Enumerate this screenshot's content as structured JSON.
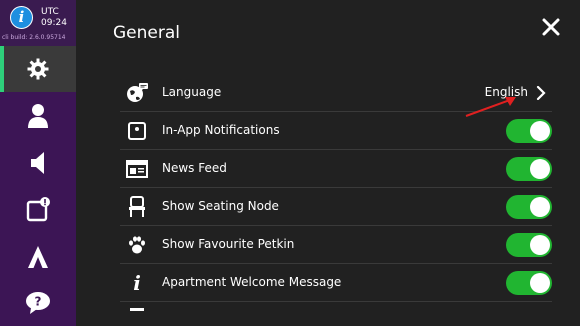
{
  "status": {
    "utc_label": "UTC",
    "time": "09:24",
    "build": "cli build: 2.6.0.95714"
  },
  "sidebar": {
    "items": [
      {
        "name": "settings",
        "icon": "gear-icon",
        "active": true
      },
      {
        "name": "profile",
        "icon": "person-icon",
        "active": false
      },
      {
        "name": "announcements",
        "icon": "megaphone-icon",
        "active": false
      },
      {
        "name": "notifications",
        "icon": "notification-icon",
        "active": false
      },
      {
        "name": "brand",
        "icon": "logo-icon",
        "active": false
      },
      {
        "name": "help",
        "icon": "help-icon",
        "active": false
      }
    ]
  },
  "page": {
    "title": "General"
  },
  "settings": [
    {
      "label": "Language",
      "icon": "globe-chat-icon",
      "value": "English"
    },
    {
      "label": "In-App Notifications",
      "icon": "notification-icon",
      "toggle": true
    },
    {
      "label": "News Feed",
      "icon": "newspaper-icon",
      "toggle": true
    },
    {
      "label": "Show Seating Node",
      "icon": "chair-icon",
      "toggle": true
    },
    {
      "label": "Show Favourite Petkin",
      "icon": "paw-icon",
      "toggle": true
    },
    {
      "label": "Apartment Welcome Message",
      "icon": "info-icon",
      "toggle": true
    }
  ],
  "colors": {
    "sidebar": "#3c1555",
    "accent": "#2ed07a",
    "toggle_on": "#21b531",
    "annotation_arrow": "#e02020"
  }
}
